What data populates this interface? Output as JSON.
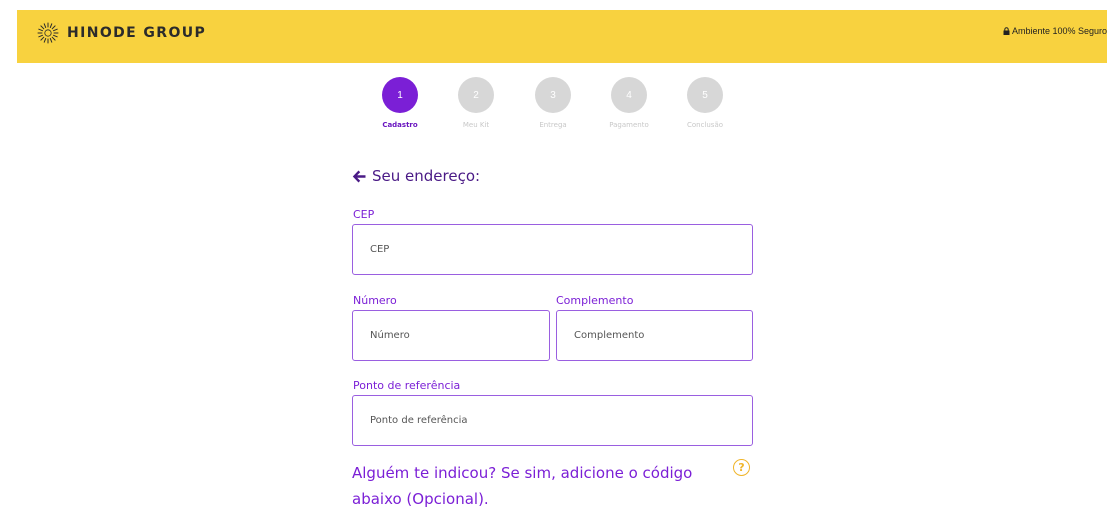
{
  "header": {
    "brand": "HINODE GROUP",
    "secure_text": "Ambiente 100% Seguro",
    "bg_color": "#f8d23f"
  },
  "steps": [
    {
      "number": "1",
      "label": "Cadastro",
      "active": true
    },
    {
      "number": "2",
      "label": "Meu Kit",
      "active": false
    },
    {
      "number": "3",
      "label": "Entrega",
      "active": false
    },
    {
      "number": "4",
      "label": "Pagamento",
      "active": false
    },
    {
      "number": "5",
      "label": "Conclusão",
      "active": false
    }
  ],
  "form": {
    "title": "Seu endereço:",
    "cep": {
      "label": "CEP",
      "placeholder": "CEP"
    },
    "numero": {
      "label": "Número",
      "placeholder": "Número"
    },
    "complemento": {
      "label": "Complemento",
      "placeholder": "Complemento"
    },
    "referencia": {
      "label": "Ponto de referência",
      "placeholder": "Ponto de referência"
    },
    "referral_question": "Alguém te indicou? Se sim, adicione o código abaixo (Opcional).",
    "help_icon": "?"
  },
  "colors": {
    "accent": "#7b1fd6",
    "step_inactive": "#d7d7d7",
    "help": "#f0b52a"
  }
}
